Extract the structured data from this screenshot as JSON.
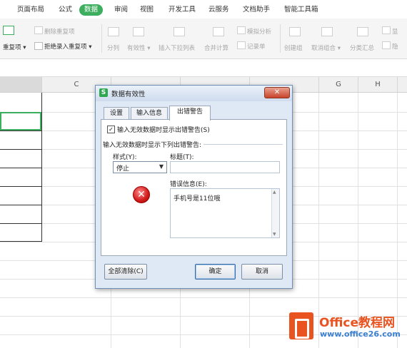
{
  "ribbon_tabs": [
    "页面布局",
    "公式",
    "数据",
    "审阅",
    "视图",
    "开发工具",
    "云服务",
    "文档助手",
    "智能工具箱"
  ],
  "active_tab": "数据",
  "ribbon": {
    "remove_duplicates": "删除重复项",
    "duplicates_dropdown": "重复项",
    "reject_duplicates": "拒绝录入重复项",
    "split": "分列",
    "validity": "有效性",
    "insert_dropdown_list": "插入下拉列表",
    "consolidate": "合并计算",
    "what_if": "模拟分析",
    "record_form": "记录单",
    "create_group": "创建组",
    "ungroup": "取消组合",
    "subtotal": "分类汇总",
    "show_detail": "显",
    "hide_detail": "隐"
  },
  "columns": [
    "C",
    "G",
    "H"
  ],
  "dialog": {
    "title": "数据有效性",
    "close_glyph": "✕",
    "tabs": [
      "设置",
      "输入信息",
      "出错警告"
    ],
    "active_tab": "出错警告",
    "show_error_checkbox_label": "输入无效数据时显示出错警告(S)",
    "show_error_checked": true,
    "section_label": "输入无效数据时显示下列出错警告:",
    "style_label": "样式(Y):",
    "style_value": "停止",
    "title_label": "标题(T):",
    "title_value": "",
    "error_message_label": "错误信息(E):",
    "error_message_value": "手机号是11位哦",
    "clear_all": "全部清除(C)",
    "ok": "确定",
    "cancel": "取消"
  },
  "watermark": {
    "title": "Office教程网",
    "url": "www.office26.com"
  },
  "colors": {
    "accent": "#3cae5e",
    "watermark_orange": "#e8531f",
    "watermark_blue": "#3a7fd0"
  }
}
